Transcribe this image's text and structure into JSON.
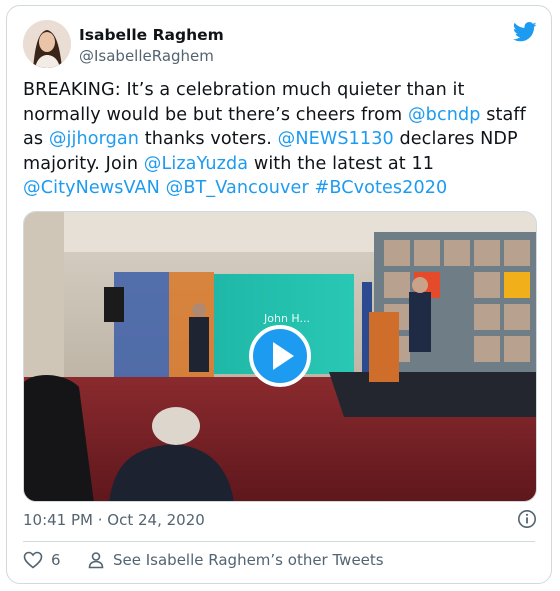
{
  "author": {
    "name": "Isabelle Raghem",
    "handle": "@IsabelleRaghem"
  },
  "tweet": {
    "t1": "BREAKING: It’s a celebration much quieter than it normally would be but there’s cheers from ",
    "m1": "@bcndp",
    "t2": " staff as ",
    "m2": "@jjhorgan",
    "t3": " thanks voters. ",
    "m3": "@NEWS1130",
    "t4": " declares NDP majority. Join ",
    "m4": "@LizaYuzda",
    "t5": " with the latest at 11 ",
    "m5": "@CityNewsVAN",
    "t6": " ",
    "m6": "@BT_Vancouver",
    "t7": " ",
    "m7": "#BCvotes2020"
  },
  "media": {
    "screen_text": "John H..."
  },
  "meta": {
    "timestamp": "10:41 PM · Oct 24, 2020"
  },
  "actions": {
    "like_count": "6",
    "other_tweets_label": "See Isabelle Raghem’s other Tweets"
  },
  "colors": {
    "link": "#1d9bf0",
    "secondary_text": "#536471",
    "border": "#cfd9de"
  },
  "icons": [
    "twitter-bird-icon",
    "play-icon",
    "info-icon",
    "heart-icon",
    "person-icon"
  ]
}
